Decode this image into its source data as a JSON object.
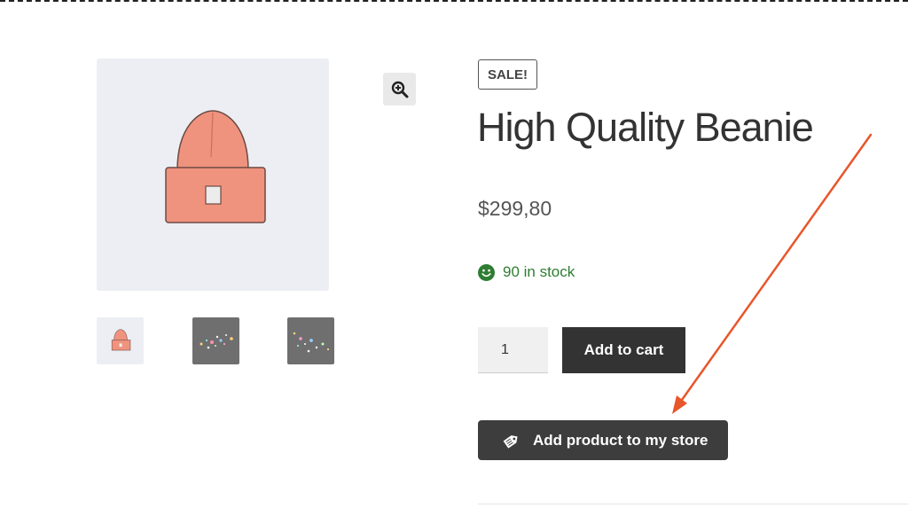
{
  "product": {
    "sale_badge": "SALE!",
    "title": "High Quality Beanie",
    "price": "$299,80",
    "stock_text": "90 in stock",
    "quantity_value": "1"
  },
  "actions": {
    "add_to_cart_label": "Add to cart",
    "add_to_store_label": "Add product to my store"
  },
  "icons": {
    "zoom": "zoom-in-icon",
    "stock": "smiley-icon",
    "store": "price-tag-icon"
  },
  "colors": {
    "stock_green": "#2f7d32",
    "button_dark": "#333333",
    "annotation_arrow": "#e8562b",
    "beanie": "#f0937e"
  }
}
